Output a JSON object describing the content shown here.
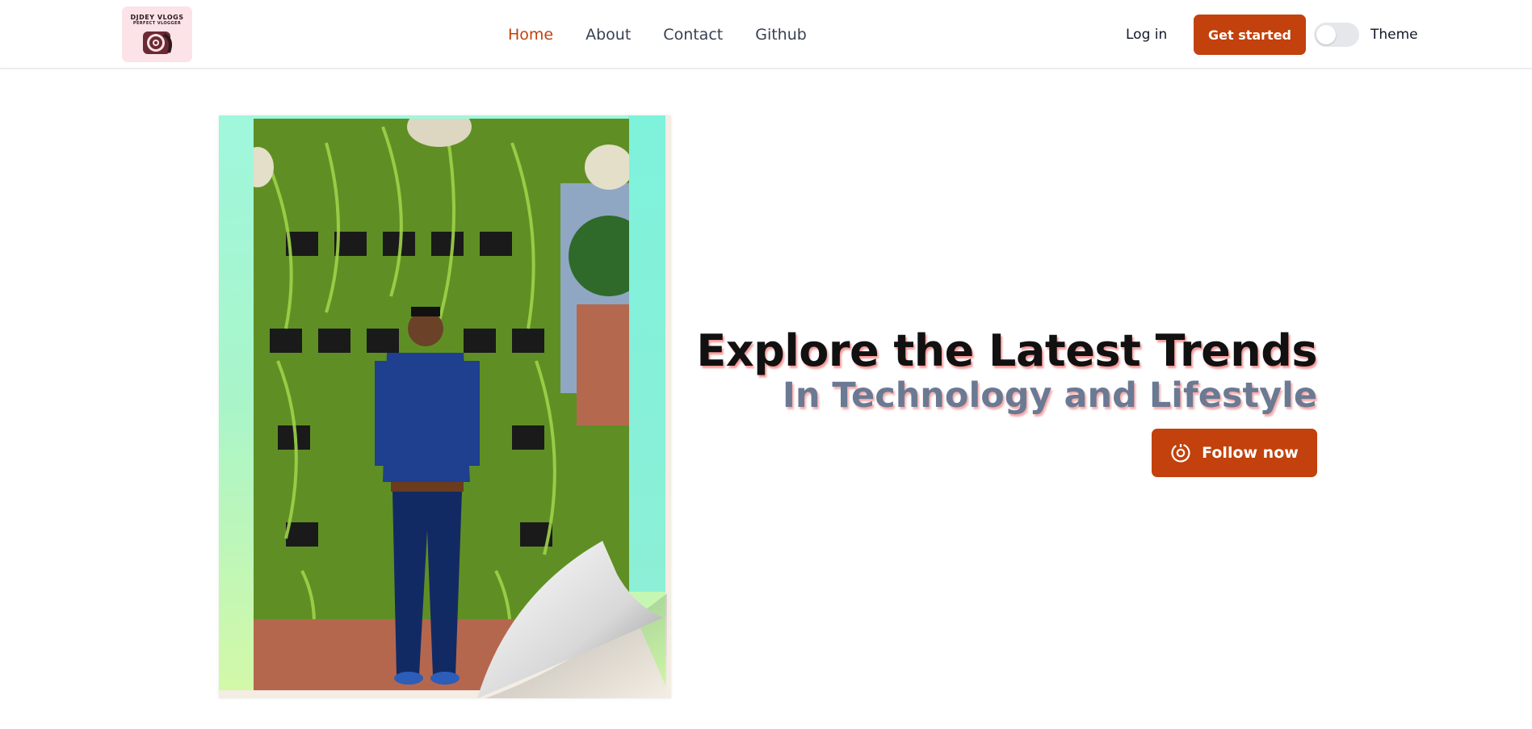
{
  "header": {
    "logo": {
      "title": "DJDEY VLOGS",
      "subtitle": "PERFECT VLOGGER"
    },
    "nav": [
      {
        "label": "Home",
        "active": true
      },
      {
        "label": "About",
        "active": false
      },
      {
        "label": "Contact",
        "active": false
      },
      {
        "label": "Github",
        "active": false
      }
    ],
    "login_label": "Log in",
    "cta_label": "Get started",
    "theme_label": "Theme",
    "theme_toggle_on": false
  },
  "hero": {
    "title": "Explore the Latest Trends",
    "subtitle": "In Technology and Lifestyle",
    "follow_label": "Follow now",
    "photo_alt": "Person standing in front of a vertical garden of hanging plants"
  },
  "colors": {
    "accent": "#c2410c",
    "subtitle": "#6b7a93",
    "text_shadow": "#ef4444"
  },
  "icons": {
    "follow_icon": "target-icon"
  }
}
